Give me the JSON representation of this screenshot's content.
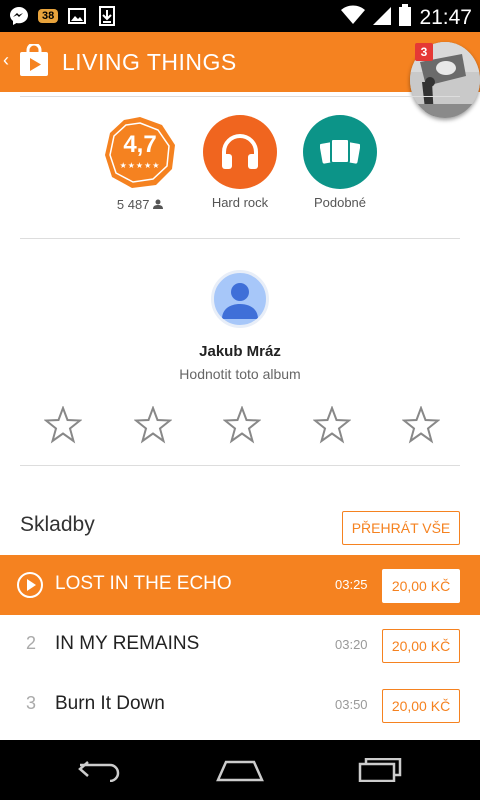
{
  "status_bar": {
    "notification_count": "38",
    "time": "21:47"
  },
  "app_bar": {
    "title": "LIVING THINGS",
    "badge": "3"
  },
  "stats": {
    "rating": "4,7",
    "rating_count": "5 487",
    "genre": "Hard rock",
    "similar": "Podobné"
  },
  "review": {
    "name": "Jakub Mráz",
    "prompt": "Hodnotit toto album",
    "stars_total": 5,
    "stars_filled": 0
  },
  "tracks_section": {
    "title": "Skladby",
    "play_all": "PŘEHRÁT VŠE"
  },
  "tracks": [
    {
      "num": "",
      "title": "LOST IN THE ECHO",
      "duration": "03:25",
      "price": "20,00 KČ"
    },
    {
      "num": "2",
      "title": "IN MY REMAINS",
      "duration": "03:20",
      "price": "20,00 KČ"
    },
    {
      "num": "3",
      "title": "Burn It Down",
      "duration": "03:50",
      "price": "20,00 KČ"
    }
  ],
  "colors": {
    "accent": "#f58220",
    "teal": "#0c9488",
    "statusbar": "#000000"
  },
  "icons": [
    "messenger-icon",
    "image-icon",
    "download-icon",
    "wifi-icon",
    "signal-icon",
    "battery-icon",
    "play-store-icon",
    "person-icon",
    "headphones-icon",
    "similar-albums-icon",
    "star-icon",
    "play-icon",
    "back-icon",
    "home-icon",
    "recents-icon"
  ]
}
